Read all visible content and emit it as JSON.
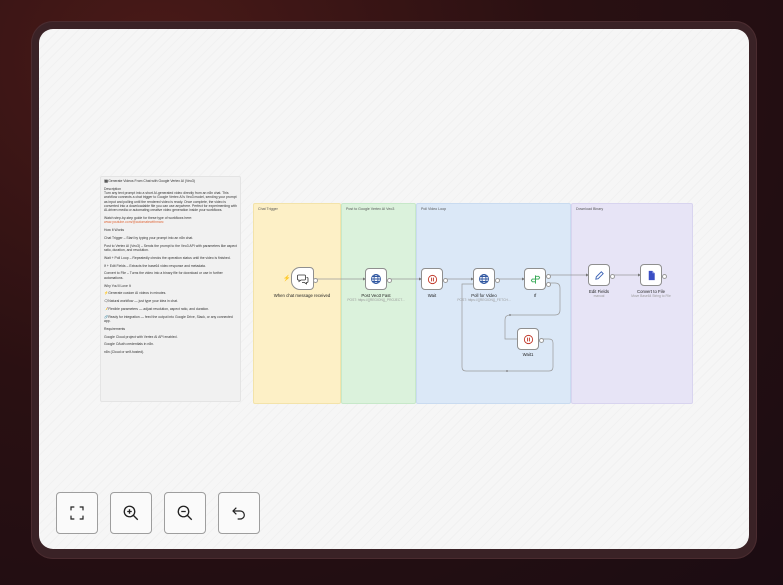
{
  "note": {
    "title": "🎬Generate Videos From Chat with Google Vertex AI (Veo3)",
    "desc_head": "Description",
    "desc": "Turn any text prompt into a short AI-generated video directly from an n8n chat. This workflow connects a chat trigger to Google Vertex AI's Veo3 model, sending your prompt as input and polling until the rendered video is ready. Once complete, the video is converted into a downloadable file you can use anywhere. Perfect for experimenting with AI-driven media or automating creative video generation inside your workflows.",
    "watch": "Watch step-by-step guide for these type of workflows here:",
    "link": "www.youtube.com/@automatewithmarc",
    "how_head": "How It Works",
    "how1": "Chat Trigger – Start by typing your prompt into an n8n chat.",
    "how2": "Post to Vertex AI (Veo3) – Sends the prompt to the Veo3 API with parameters like aspect ratio, duration, and resolution.",
    "how3": "Wait + Poll Loop – Repeatedly checks the operation status until the video is finished.",
    "how4": "If + Edit Fields – Extracts the base64 video response and metadata.",
    "how5": "Convert to File – Turns the video into a binary file for download or use in further automations.",
    "why_head": "Why You'll Love It",
    "why1": "⚡Generate custom AI videos in minutes.",
    "why2": "🗨Natural workflow — just type your idea in chat.",
    "why3": "📝Flexible parameters — adjust resolution, aspect ratio, and duration.",
    "why4": "🔗Ready for integration — feed the output into Google Drive, Slack, or any connected app.",
    "req_head": "Requirements",
    "req1": "Google Cloud project with Vertex AI API enabled.",
    "req2": "Google OAuth credentials in n8n.",
    "req3": "n8n (Cloud or self-hosted)."
  },
  "groups": {
    "g1": "Chat Trigger",
    "g2": "Post to Google Vertex AI Veo3",
    "g3": "Poll Video Loop",
    "g4": "Download Binary"
  },
  "nodes": {
    "trigger": {
      "label": "When chat message received"
    },
    "post": {
      "label": "Post Veo3 Fast",
      "sub": "POST: https://{{REGION}}_PROJECT..."
    },
    "wait": {
      "label": "Wait"
    },
    "poll": {
      "label": "Poll for Video",
      "sub": "POST: https://{{REGION}}_FETCH..."
    },
    "if": {
      "label": "If"
    },
    "wait1": {
      "label": "Wait1"
    },
    "edit": {
      "label": "Edit Fields",
      "sub": "manual"
    },
    "convert": {
      "label": "Convert to File",
      "sub": "Move Base64 String to File"
    }
  },
  "controls": [
    "fit-view",
    "zoom-in",
    "zoom-out",
    "undo"
  ],
  "colors": {
    "sticky_yellow": "#fdf0c6",
    "sticky_green": "#dbf2dc",
    "sticky_blue": "#dbe8f7",
    "sticky_purple": "#e7e4f6",
    "http_icon": "#2f56a0",
    "wait_icon": "#c0392b",
    "if_icon": "#34a853",
    "edit_icon": "#3b62b5",
    "convert_icon": "#3a4ec4"
  }
}
